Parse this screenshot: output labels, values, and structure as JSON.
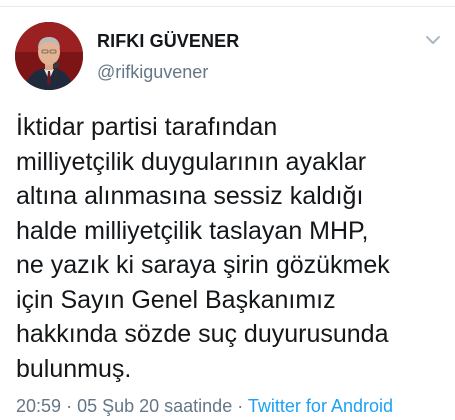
{
  "author": {
    "display_name": "RIFKI GÜVENER",
    "handle": "@rifkiguvener",
    "avatar_icon": "profile-photo"
  },
  "tweet": {
    "text": "İktidar partisi tarafından\nmilliyetçilik duygularının ayaklar\naltına alınmasına sessiz kaldığı\nhalde milliyetçilik taslayan MHP,\nne yazık ki saraya şirin gözükmek\niçin Sayın Genel Başkanımız\nhakkında sözde suç duyurusunda\nbulunmuş."
  },
  "meta": {
    "time": "20:59",
    "separator": "·",
    "date": "05 Şub 20 saatinde",
    "source": "Twitter for Android"
  },
  "menu": {
    "icon": "chevron-down-icon"
  },
  "colors": {
    "text": "#14171a",
    "secondary": "#657786",
    "link": "#1da1f2"
  }
}
